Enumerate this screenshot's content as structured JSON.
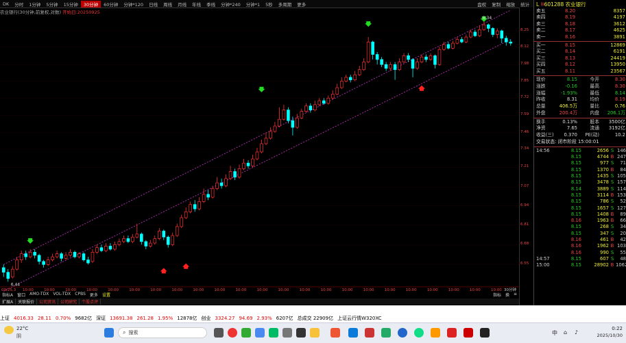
{
  "toolbar": {
    "left_icon": "DK",
    "periods": [
      "分时",
      "1分钟",
      "5分钟",
      "15分钟",
      "30分钟",
      "60分钟",
      "分钟*120",
      "日线",
      "周线",
      "月线",
      "年线",
      "季线",
      "分钟*240",
      "分钟*1",
      "5秒",
      "多周期",
      "更多"
    ],
    "selected_period": "30分钟",
    "right_items": [
      "盘权",
      "复制",
      "缩放",
      "统计",
      "画线",
      "F10",
      "标记",
      "-日历",
      "+"
    ],
    "window_controls": [
      "-",
      "▢",
      "✕"
    ]
  },
  "chart_title": {
    "name": "农业银行",
    "params": "(30分钟,前复权,对数)",
    "tail": "开始日:20250925"
  },
  "price_axis": [
    "8.25",
    "8.12",
    "7.98",
    "7.85",
    "7.72",
    "7.59",
    "7.46",
    "7.34",
    "7.21",
    "7.07",
    "6.94",
    "6.81",
    "6.68",
    "6.55"
  ],
  "time_axis": [
    "09/25,3",
    "10:00",
    "10:00",
    "10:00",
    "10:00",
    "10:00",
    "10:00",
    "10:00",
    "10:00",
    "10:00",
    "10:00",
    "10:00",
    "10:00",
    "10:00",
    "10:00",
    "10:00",
    "10:00",
    "10:00",
    "10:00",
    "10:00",
    "10:00",
    "10:00",
    "10:00",
    "10:00"
  ],
  "time_axis_right": "30分钟",
  "chart_data": {
    "type": "candlestick",
    "ylim": [
      6.42,
      8.34
    ],
    "low_label": "6.44",
    "high_label": "8.34",
    "candles": [
      [
        6.53,
        6.5,
        6.55,
        6.47
      ],
      [
        6.5,
        6.46,
        6.52,
        6.44
      ],
      [
        6.47,
        6.52,
        6.54,
        6.46
      ],
      [
        6.52,
        6.58,
        6.6,
        6.51
      ],
      [
        6.58,
        6.62,
        6.64,
        6.56
      ],
      [
        6.62,
        6.6,
        6.64,
        6.58
      ],
      [
        6.6,
        6.63,
        6.65,
        6.59
      ],
      [
        6.63,
        6.61,
        6.65,
        6.59
      ],
      [
        6.61,
        6.57,
        6.62,
        6.55
      ],
      [
        6.57,
        6.55,
        6.58,
        6.53
      ],
      [
        6.55,
        6.58,
        6.6,
        6.54
      ],
      [
        6.58,
        6.6,
        6.62,
        6.57
      ],
      [
        6.6,
        6.62,
        6.64,
        6.59
      ],
      [
        6.62,
        6.59,
        6.63,
        6.57
      ],
      [
        6.59,
        6.61,
        6.63,
        6.58
      ],
      [
        6.61,
        6.63,
        6.65,
        6.6
      ],
      [
        6.63,
        6.6,
        6.64,
        6.59
      ],
      [
        6.6,
        6.62,
        6.63,
        6.59
      ],
      [
        6.62,
        6.58,
        6.63,
        6.57
      ],
      [
        6.58,
        6.56,
        6.6,
        6.55
      ],
      [
        6.57,
        6.63,
        6.65,
        6.56
      ],
      [
        6.63,
        6.66,
        6.68,
        6.62
      ],
      [
        6.66,
        6.64,
        6.68,
        6.63
      ],
      [
        6.64,
        6.67,
        6.69,
        6.63
      ],
      [
        6.67,
        6.65,
        6.69,
        6.64
      ],
      [
        6.65,
        6.68,
        6.7,
        6.64
      ],
      [
        6.68,
        6.7,
        6.72,
        6.67
      ],
      [
        6.7,
        6.72,
        6.74,
        6.69
      ],
      [
        6.72,
        6.7,
        6.74,
        6.69
      ],
      [
        6.7,
        6.73,
        6.75,
        6.69
      ],
      [
        6.73,
        6.75,
        6.82,
        6.72
      ],
      [
        6.75,
        6.7,
        6.76,
        6.68
      ],
      [
        6.7,
        6.67,
        6.71,
        6.65
      ],
      [
        6.67,
        6.69,
        6.71,
        6.66
      ],
      [
        6.69,
        6.72,
        6.74,
        6.68
      ],
      [
        6.72,
        6.77,
        6.79,
        6.71
      ],
      [
        6.77,
        6.73,
        6.78,
        6.71
      ],
      [
        6.73,
        6.68,
        6.74,
        6.66
      ],
      [
        6.68,
        6.74,
        6.76,
        6.67
      ],
      [
        6.74,
        6.8,
        6.82,
        6.73
      ],
      [
        6.8,
        6.86,
        6.88,
        6.79
      ],
      [
        6.86,
        6.9,
        6.93,
        6.85
      ],
      [
        6.9,
        6.95,
        6.97,
        6.89
      ],
      [
        6.95,
        6.92,
        6.98,
        6.9
      ],
      [
        6.92,
        6.97,
        7.0,
        6.91
      ],
      [
        6.97,
        7.02,
        7.06,
        6.96
      ],
      [
        7.02,
        7.0,
        7.05,
        6.98
      ],
      [
        7.0,
        7.06,
        7.08,
        6.99
      ],
      [
        7.06,
        7.1,
        7.14,
        7.05
      ],
      [
        7.1,
        7.08,
        7.13,
        7.06
      ],
      [
        7.08,
        7.13,
        7.16,
        7.07
      ],
      [
        7.13,
        7.18,
        7.22,
        7.12
      ],
      [
        7.18,
        7.14,
        7.2,
        7.12
      ],
      [
        7.14,
        7.2,
        7.23,
        7.13
      ],
      [
        7.2,
        7.24,
        7.27,
        7.19
      ],
      [
        7.24,
        7.22,
        7.26,
        7.2
      ],
      [
        7.22,
        7.27,
        7.3,
        7.21
      ],
      [
        7.27,
        7.32,
        7.35,
        7.26
      ],
      [
        7.32,
        7.38,
        7.41,
        7.31
      ],
      [
        7.38,
        7.42,
        7.46,
        7.37
      ],
      [
        7.42,
        7.47,
        7.5,
        7.41
      ],
      [
        7.47,
        7.51,
        7.54,
        7.46
      ],
      [
        7.51,
        7.56,
        7.65,
        7.5
      ],
      [
        7.56,
        7.63,
        7.67,
        7.55
      ],
      [
        7.63,
        7.55,
        7.65,
        7.53
      ],
      [
        7.55,
        7.5,
        7.58,
        7.44
      ],
      [
        7.5,
        7.57,
        7.6,
        7.49
      ],
      [
        7.57,
        7.62,
        7.64,
        7.56
      ],
      [
        7.62,
        7.66,
        7.68,
        7.61
      ],
      [
        7.66,
        7.63,
        7.68,
        7.61
      ],
      [
        7.63,
        7.67,
        7.7,
        7.62
      ],
      [
        7.67,
        7.7,
        7.72,
        7.66
      ],
      [
        7.7,
        7.68,
        7.72,
        7.67
      ],
      [
        7.68,
        7.72,
        7.74,
        7.67
      ],
      [
        7.72,
        7.75,
        7.78,
        7.71
      ],
      [
        7.75,
        7.8,
        7.83,
        7.74
      ],
      [
        7.8,
        7.85,
        7.88,
        7.79
      ],
      [
        7.85,
        7.88,
        7.9,
        7.84
      ],
      [
        7.88,
        7.86,
        7.9,
        7.84
      ],
      [
        7.86,
        7.9,
        7.93,
        7.85
      ],
      [
        7.9,
        7.94,
        7.97,
        7.89
      ],
      [
        7.94,
        8.0,
        8.03,
        7.93
      ],
      [
        8.0,
        8.16,
        8.2,
        7.99
      ],
      [
        8.16,
        8.06,
        8.17,
        8.02
      ],
      [
        8.06,
        8.02,
        8.08,
        7.98
      ],
      [
        8.02,
        7.98,
        8.04,
        7.96
      ],
      [
        7.98,
        7.95,
        8.0,
        7.93
      ],
      [
        7.95,
        7.98,
        8.0,
        7.93
      ],
      [
        7.98,
        7.94,
        8.0,
        7.86
      ],
      [
        7.94,
        8.0,
        8.03,
        7.93
      ],
      [
        8.0,
        8.05,
        8.07,
        7.99
      ],
      [
        8.05,
        8.02,
        8.07,
        8.0
      ],
      [
        8.02,
        7.95,
        8.03,
        7.88
      ],
      [
        7.95,
        8.0,
        8.03,
        7.94
      ],
      [
        8.0,
        8.04,
        8.06,
        7.99
      ],
      [
        8.04,
        8.02,
        8.06,
        8.0
      ],
      [
        8.02,
        8.05,
        8.07,
        8.01
      ],
      [
        8.05,
        7.98,
        8.06,
        7.95
      ],
      [
        7.98,
        8.1,
        8.12,
        7.97
      ],
      [
        8.1,
        8.14,
        8.16,
        8.09
      ],
      [
        8.14,
        8.11,
        8.16,
        8.1
      ],
      [
        8.11,
        8.15,
        8.17,
        8.1
      ],
      [
        8.15,
        8.18,
        8.2,
        8.14
      ],
      [
        8.18,
        8.16,
        8.2,
        8.15
      ],
      [
        8.16,
        8.2,
        8.22,
        8.15
      ],
      [
        8.2,
        8.24,
        8.26,
        8.19
      ],
      [
        8.24,
        8.21,
        8.26,
        8.2
      ],
      [
        8.21,
        8.26,
        8.29,
        8.2
      ],
      [
        8.26,
        8.3,
        8.34,
        8.25
      ],
      [
        8.3,
        8.27,
        8.31,
        8.24
      ],
      [
        8.27,
        8.22,
        8.28,
        8.2
      ],
      [
        8.22,
        8.25,
        8.27,
        8.19
      ],
      [
        8.25,
        8.19,
        8.26,
        8.15
      ],
      [
        8.19,
        8.16,
        8.21,
        8.13
      ],
      [
        8.16,
        8.15,
        8.18,
        8.13
      ]
    ],
    "channel_upper": [
      [
        0,
        6.55
      ],
      [
        114,
        8.42
      ]
    ],
    "channel_lower": [
      [
        0,
        6.38
      ],
      [
        114,
        8.18
      ]
    ],
    "down_arrows": [
      [
        6,
        6.7
      ],
      [
        58,
        7.78
      ],
      [
        82,
        8.3
      ],
      [
        108,
        8.34
      ]
    ],
    "up_arrows": [
      [
        36,
        6.63
      ],
      [
        41,
        6.66
      ],
      [
        94,
        7.94
      ]
    ]
  },
  "indicator_tabs": [
    "指标A",
    "窗口",
    "AMO-TDX",
    "VOL-TDX",
    "CPBS",
    "更多",
    "设置"
  ],
  "indicator_right": [
    "指标",
    "换",
    "≡"
  ],
  "bottom_tabs": [
    "扩展A",
    "关联报价",
    "公司资讯",
    "公司研究",
    "个股点评"
  ],
  "stock": {
    "code": "601288",
    "name": "农业银行",
    "flag": "L",
    "tag": "融"
  },
  "order_book": {
    "asks": [
      {
        "label": "卖五",
        "price": "8.20",
        "vol": "8357"
      },
      {
        "label": "卖四",
        "price": "8.19",
        "vol": "4197"
      },
      {
        "label": "卖三",
        "price": "8.18",
        "vol": "3612"
      },
      {
        "label": "卖二",
        "price": "8.17",
        "vol": "4625"
      },
      {
        "label": "卖一",
        "price": "8.16",
        "vol": "3891"
      }
    ],
    "bids": [
      {
        "label": "买一",
        "price": "8.15",
        "vol": "12869"
      },
      {
        "label": "买二",
        "price": "8.14",
        "vol": "6191"
      },
      {
        "label": "买三",
        "price": "8.13",
        "vol": "24419"
      },
      {
        "label": "买四",
        "price": "8.12",
        "vol": "13950"
      },
      {
        "label": "买五",
        "price": "8.11",
        "vol": "23567"
      }
    ]
  },
  "quote": [
    {
      "l": "现价",
      "a": "8.15",
      "l2": "今开",
      "b": "8.30"
    },
    {
      "l": "涨跌",
      "a": "-0.16",
      "l2": "最高",
      "b": "8.30"
    },
    {
      "l": "涨幅",
      "a": "-1.93%",
      "l2": "最低",
      "b": "8.14"
    },
    {
      "l": "昨收",
      "a": "8.31",
      "l2": "均价",
      "b": "8.19"
    },
    {
      "l": "总量",
      "a": "406.5万",
      "l2": "量比",
      "b": "0.76"
    },
    {
      "l": "外盘",
      "a": "200.4万",
      "l2": "内盘",
      "b": "206.1万"
    },
    {
      "l": "换手",
      "a": "0.13%",
      "l2": "股本",
      "b": "3500亿"
    },
    {
      "l": "净资",
      "a": "7.65",
      "l2": "流通",
      "b": "3192亿"
    },
    {
      "l": "收益(三)",
      "a": "0.370",
      "l2": "PE(动)",
      "b": "10.2"
    }
  ],
  "trade_status": "交易状态: 闭市阶段 15:00:01",
  "ticks": [
    {
      "t": "14:56",
      "p": "8.15",
      "v": "2656",
      "f": "S",
      "n": "146"
    },
    {
      "t": "",
      "p": "8.15",
      "v": "4744",
      "f": "B",
      "n": "247"
    },
    {
      "t": "",
      "p": "8.15",
      "v": "977",
      "f": "S",
      "n": "71"
    },
    {
      "t": "",
      "p": "8.15",
      "v": "1370",
      "f": "B",
      "n": "84"
    },
    {
      "t": "",
      "p": "8.15",
      "v": "1435",
      "f": "S",
      "n": "105"
    },
    {
      "t": "",
      "p": "8.15",
      "v": "3478",
      "f": "S",
      "n": "157"
    },
    {
      "t": "",
      "p": "8.14",
      "v": "3889",
      "f": "S",
      "n": "114"
    },
    {
      "t": "",
      "p": "8.15",
      "v": "3114",
      "f": "B",
      "n": "153"
    },
    {
      "t": "",
      "p": "8.15",
      "v": "786",
      "f": "S",
      "n": "52"
    },
    {
      "t": "",
      "p": "8.15",
      "v": "1657",
      "f": "S",
      "n": "127"
    },
    {
      "t": "",
      "p": "8.15",
      "v": "1408",
      "f": "B",
      "n": "89"
    },
    {
      "t": "",
      "p": "8.16",
      "v": "1963",
      "f": "B",
      "n": "66"
    },
    {
      "t": "",
      "p": "8.15",
      "v": "268",
      "f": "S",
      "n": "34"
    },
    {
      "t": "",
      "p": "8.15",
      "v": "347",
      "f": "S",
      "n": "20"
    },
    {
      "t": "",
      "p": "8.16",
      "v": "461",
      "f": "B",
      "n": "42"
    },
    {
      "t": "",
      "p": "8.16",
      "v": "1962",
      "f": "B",
      "n": "103"
    },
    {
      "t": "",
      "p": "8.16",
      "v": "990",
      "f": "S",
      "n": "55"
    },
    {
      "t": "14:57",
      "p": "8.15",
      "v": "607",
      "f": "S",
      "n": "48"
    },
    {
      "t": "15:00",
      "p": "8.15",
      "v": "28902",
      "f": "B",
      "n": "1062"
    }
  ],
  "ticker": {
    "items": [
      {
        "name": "上证",
        "val": "4016.33",
        "chg": "28.11",
        "pct": "0.70%",
        "amt": "9682亿"
      },
      {
        "name": "深证",
        "val": "13691.38",
        "chg": "261.28",
        "pct": "1.95%",
        "amt": "12878亿"
      },
      {
        "name": "创业",
        "val": "3324.27",
        "chg": "94.69",
        "pct": "2.93%",
        "amt": "6207亿"
      }
    ],
    "total": "总成交 22909亿",
    "notice": "上证云行情W320XC"
  },
  "taskbar": {
    "weather_temp": "22°C",
    "weather_desc": "阴",
    "search_placeholder": "搜索",
    "time": "0:22",
    "date": "2025/10/30",
    "tray": "中"
  },
  "colors": {
    "up": "#ff3333",
    "down": "#00ffff",
    "channel": "#cc33cc",
    "arrow_down": "#22dd22",
    "arrow_up": "#ff2222"
  }
}
